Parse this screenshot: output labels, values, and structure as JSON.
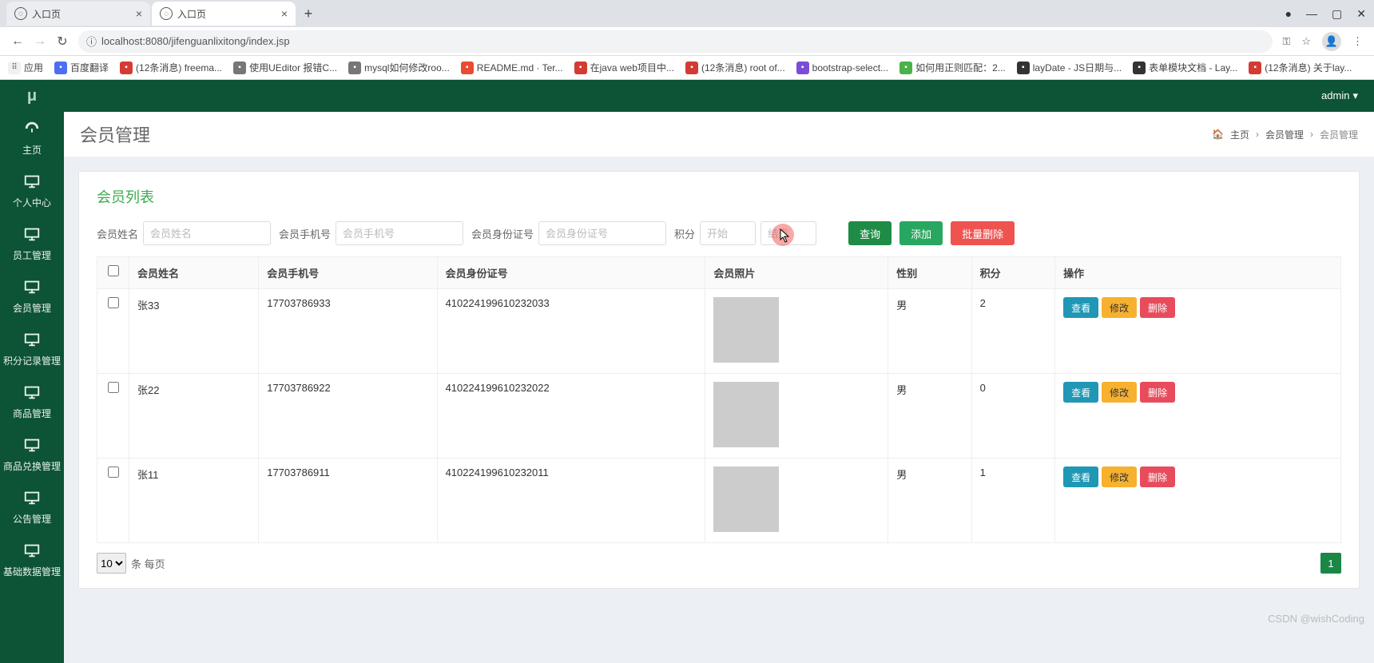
{
  "browser": {
    "tabs": [
      {
        "title": "入口页",
        "active": false
      },
      {
        "title": "入口页",
        "active": true
      }
    ],
    "url": "localhost:8080/jifenguanlixitong/index.jsp",
    "bookmarks_label": "应用",
    "bookmarks": [
      {
        "label": "百度翻译",
        "color": "#4e6ef2"
      },
      {
        "label": "(12条消息) freema...",
        "color": "#d43b33"
      },
      {
        "label": "使用UEditor 报错C...",
        "color": "#777"
      },
      {
        "label": "mysql如何修改roo...",
        "color": "#777"
      },
      {
        "label": "README.md · Ter...",
        "color": "#e84c30"
      },
      {
        "label": "在java web项目中...",
        "color": "#d43b33"
      },
      {
        "label": "(12条消息) root of...",
        "color": "#d43b33"
      },
      {
        "label": "bootstrap-select...",
        "color": "#7a4fd6"
      },
      {
        "label": "如何用正则匹配：2...",
        "color": "#4bb14b"
      },
      {
        "label": "layDate - JS日期与...",
        "color": "#333"
      },
      {
        "label": "表单模块文档 - Lay...",
        "color": "#333"
      },
      {
        "label": "(12条消息) 关于lay...",
        "color": "#d43b33"
      }
    ]
  },
  "header": {
    "user": "admin"
  },
  "sidebar": {
    "logo": "μ",
    "items": [
      {
        "key": "home",
        "label": "主页",
        "icon": "dashboard"
      },
      {
        "key": "personal",
        "label": "个人中心",
        "icon": "monitor"
      },
      {
        "key": "staff",
        "label": "员工管理",
        "icon": "monitor"
      },
      {
        "key": "member",
        "label": "会员管理",
        "icon": "monitor"
      },
      {
        "key": "points",
        "label": "积分记录管理",
        "icon": "monitor"
      },
      {
        "key": "goods",
        "label": "商品管理",
        "icon": "monitor"
      },
      {
        "key": "exchange",
        "label": "商品兑换管理",
        "icon": "monitor"
      },
      {
        "key": "notice",
        "label": "公告管理",
        "icon": "monitor"
      },
      {
        "key": "basedata",
        "label": "基础数据管理",
        "icon": "monitor"
      }
    ]
  },
  "page": {
    "title": "会员管理",
    "breadcrumb": [
      "主页",
      "会员管理",
      "会员管理"
    ]
  },
  "panel": {
    "title": "会员列表",
    "filters": {
      "name_label": "会员姓名",
      "name_ph": "会员姓名",
      "phone_label": "会员手机号",
      "phone_ph": "会员手机号",
      "idcard_label": "会员身份证号",
      "idcard_ph": "会员身份证号",
      "points_label": "积分",
      "points_start_ph": "开始",
      "points_end_ph": "结束"
    },
    "buttons": {
      "search": "查询",
      "add": "添加",
      "batch_delete": "批量删除"
    },
    "columns": [
      "",
      "会员姓名",
      "会员手机号",
      "会员身份证号",
      "会员照片",
      "性别",
      "积分",
      "操作"
    ],
    "row_buttons": {
      "view": "查看",
      "edit": "修改",
      "delete": "删除"
    },
    "rows": [
      {
        "name": "张33",
        "phone": "17703786933",
        "idcard": "410224199610232033",
        "gender": "男",
        "points": "2"
      },
      {
        "name": "张22",
        "phone": "17703786922",
        "idcard": "410224199610232022",
        "gender": "男",
        "points": "0"
      },
      {
        "name": "张11",
        "phone": "17703786911",
        "idcard": "410224199610232011",
        "gender": "男",
        "points": "1"
      }
    ],
    "pager": {
      "size": "10",
      "per_text": "条 每页",
      "current": "1"
    }
  },
  "watermark": "CSDN @wishCoding"
}
